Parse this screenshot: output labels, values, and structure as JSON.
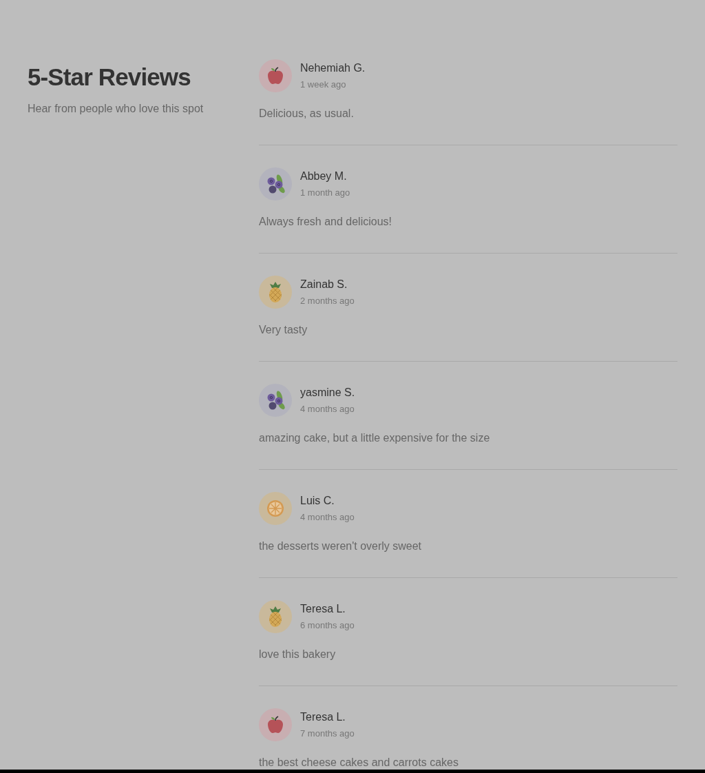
{
  "header": {
    "title": "5-Star Reviews",
    "subtitle": "Hear from people who love this spot"
  },
  "reviews": [
    {
      "name": "Nehemiah G.",
      "time": "1 week ago",
      "text": "Delicious, as usual.",
      "avatar": {
        "kind": "apple"
      }
    },
    {
      "name": "Abbey M.",
      "time": "1 month ago",
      "text": "Always fresh and delicious!",
      "avatar": {
        "kind": "blueberry"
      }
    },
    {
      "name": "Zainab S.",
      "time": "2 months ago",
      "text": "Very tasty",
      "avatar": {
        "kind": "pineapple"
      }
    },
    {
      "name": "yasmine S.",
      "time": "4 months ago",
      "text": "amazing cake, but a little expensive for the size",
      "avatar": {
        "kind": "blueberry"
      }
    },
    {
      "name": "Luis C.",
      "time": "4 months ago",
      "text": "the desserts weren't overly sweet",
      "avatar": {
        "kind": "orange"
      }
    },
    {
      "name": "Teresa L.",
      "time": "6 months ago",
      "text": "love this bakery",
      "avatar": {
        "kind": "pineapple"
      }
    },
    {
      "name": "Teresa L.",
      "time": "7 months ago",
      "text": "the best cheese cakes and carrots cakes",
      "avatar": {
        "kind": "apple"
      }
    }
  ]
}
